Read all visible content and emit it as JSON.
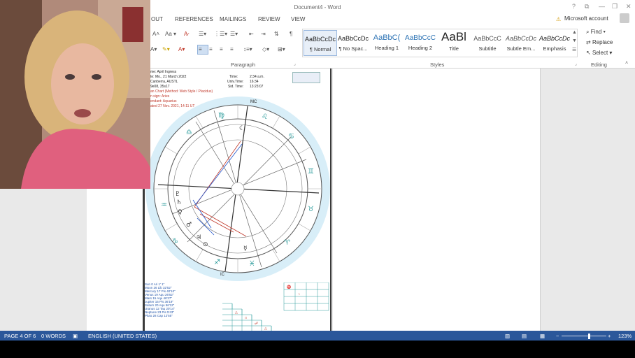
{
  "window": {
    "title": "Document4 - Word",
    "help": "?",
    "ribbon_display": "⧉",
    "minimize": "—",
    "restore": "❐",
    "close": "✕"
  },
  "tabs": [
    "OUT",
    "REFERENCES",
    "MAILINGS",
    "REVIEW",
    "VIEW"
  ],
  "account": {
    "label": "Microsoft account"
  },
  "groups": {
    "paragraph": "Paragraph",
    "styles": "Styles",
    "editing": "Editing"
  },
  "styles": [
    {
      "preview": "AaBbCcDc",
      "name": "¶ Normal"
    },
    {
      "preview": "AaBbCcDc",
      "name": "¶ No Spac..."
    },
    {
      "preview": "AaBbC(",
      "name": "Heading 1"
    },
    {
      "preview": "AaBbCcC",
      "name": "Heading 2"
    },
    {
      "preview": "AaBl",
      "name": "Title"
    },
    {
      "preview": "AaBbCcC",
      "name": "Subtitle"
    },
    {
      "preview": "AaBbCcDc",
      "name": "Subtle Em..."
    },
    {
      "preview": "AaBbCcDc",
      "name": "Emphasis"
    }
  ],
  "editing": {
    "find": "Find",
    "replace": "Replace",
    "select": "Select"
  },
  "chart_header": {
    "l1": "me: April Ingress",
    "l2": "te: Mo., 21 March 2022",
    "l3": "Canberra, AUSTL",
    "l4": "9e08, 35s17",
    "r1a": "Time:",
    "r1b": "2:34 a.m.",
    "r2a": "Univ.Time:",
    "r2b": "16:34",
    "r3a": "Sid. Time:",
    "r3b": "13:23:07",
    "red1": "an Chart (Method: Web Style / Placidus)",
    "red2": "n sign: Aries",
    "red3": "endant: Aquarius",
    "red4": "ated 27 Nov. 2021, 14:11 UT"
  },
  "planets": [
    {
      "name": "Sun",
      "pos": "0  Ari  1' 1\""
    },
    {
      "name": "Moon",
      "pos": "26  Lib 32'52\""
    },
    {
      "name": "Mercury",
      "pos": "17  Pis 40'10\""
    },
    {
      "name": "Venus",
      "pos": "19  Aqu 26'52\""
    },
    {
      "name": "Mars",
      "pos": "15  Aqu 46'27\""
    },
    {
      "name": "Jupiter",
      "pos": "15  Pis 36'19\""
    },
    {
      "name": "Saturn",
      "pos": "20  Aqu 56'12\""
    },
    {
      "name": "Uranus",
      "pos": "12  Tau 20'14\""
    },
    {
      "name": "Neptune",
      "pos": "23  Pis  5'43\""
    },
    {
      "name": "Pluto",
      "pos": "28  Cap 12'55\""
    }
  ],
  "mc_label": "MC",
  "ic_label": "IC",
  "status": {
    "page": "PAGE 4 OF 6",
    "words": "0 WORDS",
    "language": "ENGLISH (UNITED STATES)",
    "zoom": "123%",
    "zoom_level": 0.62,
    "zoom_minus": "−",
    "zoom_plus": "+"
  },
  "colors": {
    "accent": "#2b579a",
    "ribbon_bg": "#ffffff",
    "doc_bg": "#e9e9e9",
    "webcam_shirt": "#e0607e"
  }
}
